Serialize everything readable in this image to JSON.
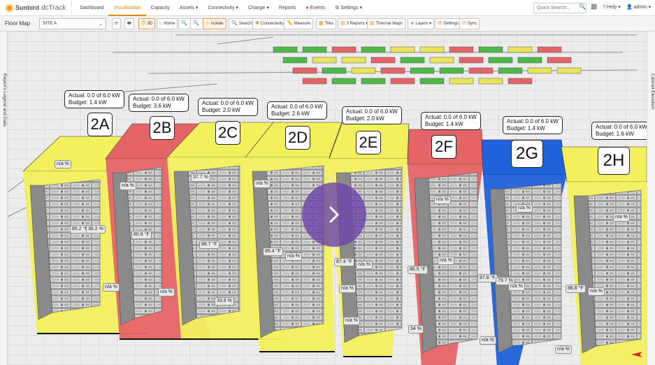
{
  "nav": {
    "brand": "Sunbird",
    "product": "dcTrack",
    "items": [
      {
        "label": "Dashboard"
      },
      {
        "label": "Visualization",
        "active": true
      },
      {
        "label": "Capacity"
      },
      {
        "label": "Assets ▾"
      },
      {
        "label": "Connectivity ▾"
      },
      {
        "label": "Change ▾"
      },
      {
        "label": "Reports"
      },
      {
        "label": "Events",
        "alert": true
      },
      {
        "label": "⚙ Settings ▾"
      }
    ],
    "search_placeholder": "Quick Search...",
    "help": "? Help ▾",
    "user": "👤 admin ▾"
  },
  "toolbar": {
    "title": "Floor Map",
    "site": "SITE A",
    "buttons": [
      {
        "icon": "🗊",
        "label": "3D",
        "sel": true
      },
      {
        "icon": "⌂",
        "label": "Home"
      },
      {
        "icon": "🔍",
        "label": ""
      },
      {
        "icon": "🔍",
        "label": ""
      },
      {
        "icon": "⊹",
        "label": "Isolate",
        "sel": true
      },
      {
        "icon": "🔍",
        "label": "Search"
      },
      {
        "icon": "✱",
        "label": "Connectivity"
      },
      {
        "icon": "📏",
        "label": "Measure"
      },
      {
        "icon": "▦",
        "label": "Tiles"
      },
      {
        "icon": "▤",
        "label": "3 Reports ▾"
      },
      {
        "icon": "▥",
        "label": "Thermal Maps"
      },
      {
        "icon": "◈",
        "label": "Layers ▾"
      },
      {
        "icon": "⚙",
        "label": "Settings"
      },
      {
        "icon": "⟳",
        "label": "Sync"
      }
    ]
  },
  "side": {
    "left": "Report's Legend and Data",
    "right": "Cabinet Elevation"
  },
  "colors": {
    "yellow": "#f3f05e",
    "red": "#e56467",
    "blue": "#1f62d9",
    "accent": "#e08a12"
  },
  "cabinets": [
    {
      "name": "2A",
      "actual": "Actual: 0.0 of 6.0 kW",
      "budget": "Budget: 1.4 kW",
      "color": "yellow"
    },
    {
      "name": "2B",
      "actual": "Actual: 0.0 of 6.0 kW",
      "budget": "Budget: 3.6 kW",
      "color": "red"
    },
    {
      "name": "2C",
      "actual": "Actual: 0.0 of 6.0 kW",
      "budget": "Budget: 2.0 kW",
      "color": "yellow"
    },
    {
      "name": "2D",
      "actual": "Actual: 0.0 of 6.0 kW",
      "budget": "Budget: 2.6 kW",
      "color": "yellow"
    },
    {
      "name": "2E",
      "actual": "Actual: 0.0 of 6.0 kW",
      "budget": "Budget: 2.0 kW",
      "color": "yellow"
    },
    {
      "name": "2F",
      "actual": "Actual: 0.0 of 6.0 kW",
      "budget": "Budget: 1.4 kW",
      "color": "red"
    },
    {
      "name": "2G",
      "actual": "Actual: 0.0 of 6.0 kW",
      "budget": "Budget: 1.4 kW",
      "color": "blue"
    },
    {
      "name": "2H",
      "actual": "Actual: 0.0 of 6.0 kW",
      "budget": "Budget: 1.6 kW",
      "color": "yellow"
    }
  ],
  "sensors": [
    "n/a %",
    "85.2 °F",
    "36.2 %",
    "n/a %",
    "n/a %",
    "80.9 °F",
    "n/a %",
    "37.7 %",
    "86.7 °F",
    "33.6 %",
    "n/a %",
    "85.4 °F",
    "n/a %",
    "n/a %",
    "87.4 °F",
    "n/a %",
    "n/a %",
    "n/a %",
    "86.5 °F",
    "n/a %",
    "34 %",
    "n/a %",
    "87.8 °F",
    "79.7 %",
    "n/a %",
    "n/a %",
    "n/a %",
    "88.8 °F",
    "n/a %",
    "n/a %"
  ]
}
